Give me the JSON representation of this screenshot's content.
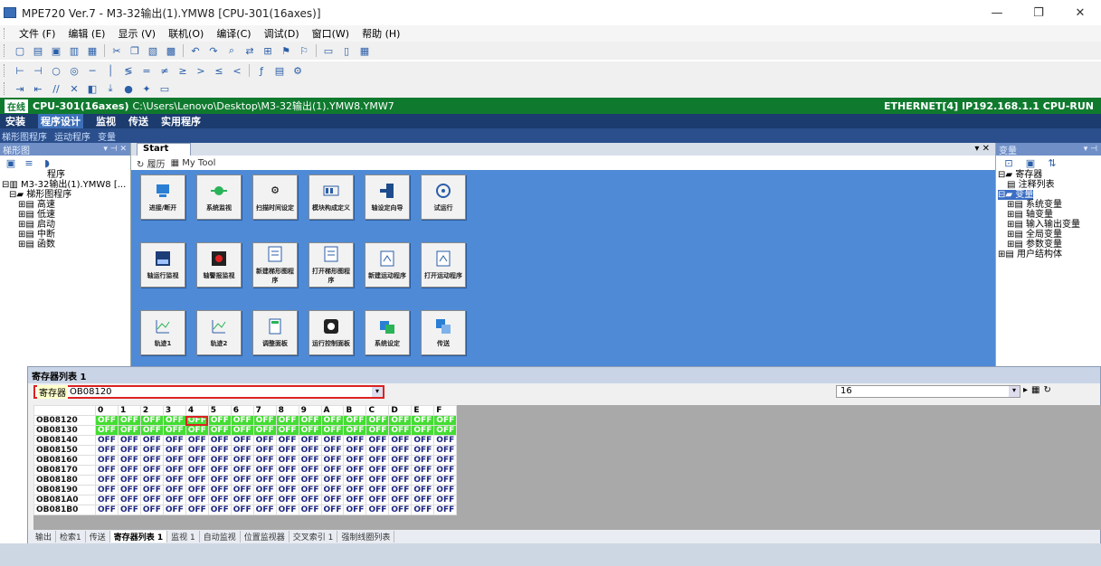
{
  "window": {
    "title": "MPE720 Ver.7 - M3-32输出(1).YMW8 [CPU-301(16axes)]",
    "controls": [
      "—",
      "❐",
      "✕"
    ]
  },
  "menu": [
    "文件 (F)",
    "编辑 (E)",
    "显示 (V)",
    "联机(O)",
    "编译(C)",
    "调试(D)",
    "窗口(W)",
    "帮助 (H)"
  ],
  "online": {
    "badge": "在线",
    "cpu": "CPU-301(16axes)",
    "path": "C:\\Users\\Lenovo\\Desktop\\M3-32输出(1).YMW8.YMW7",
    "connection": "ETHERNET[4] IP192.168.1.1 CPU-RUN",
    "color": "#0f7a2e"
  },
  "mainmenu": {
    "row1": [
      "安装",
      "程序设计",
      "监视",
      "传送",
      "实用程序"
    ],
    "active": "程序设计",
    "row2": [
      "梯形图程序",
      "运动程序",
      "变量"
    ]
  },
  "left": {
    "header": "梯形图",
    "tree": {
      "root_label": "程序",
      "project": "M3-32输出(1).YMW8 [...",
      "ladder": "梯形图程序",
      "children": [
        "高速",
        "低速",
        "启动",
        "中断",
        "函数"
      ]
    }
  },
  "center": {
    "tab": "Start",
    "subtoolbar": [
      "履历",
      "My Tool"
    ],
    "tiles": [
      [
        "进接/断开",
        "系统监视",
        "扫描时间设定",
        "模块构成定义",
        "轴设定向导",
        "试运行"
      ],
      [
        "轴运行监视",
        "轴警报监视",
        "新建梯形图程序",
        "打开梯形图程序",
        "新建运动程序",
        "打开运动程序"
      ],
      [
        "轨迹1",
        "轨迹2",
        "调整面板",
        "运行控制面板",
        "系统设定",
        "传送"
      ]
    ]
  },
  "right": {
    "header": "变量",
    "tree": [
      "寄存器",
      "注释列表",
      "变量",
      "系统变量",
      "轴变量",
      "输入输出变量",
      "全局变量",
      "参数变量",
      "用户结构体"
    ]
  },
  "registers": {
    "title": "寄存器列表 1",
    "combo_label": "寄存器",
    "combo_value": "OB08120",
    "size": "16",
    "columns": [
      "",
      "0",
      "1",
      "2",
      "3",
      "4",
      "5",
      "6",
      "7",
      "8",
      "9",
      "A",
      "B",
      "C",
      "D",
      "E",
      "F"
    ],
    "rows": [
      {
        "addr": "OB08120",
        "values": [
          "OFF",
          "OFF",
          "OFF",
          "OFF",
          "OFF",
          "OFF",
          "OFF",
          "OFF",
          "OFF",
          "OFF",
          "OFF",
          "OFF",
          "OFF",
          "OFF",
          "OFF",
          "OFF"
        ],
        "green": true
      },
      {
        "addr": "OB08130",
        "values": [
          "OFF",
          "OFF",
          "OFF",
          "OFF",
          "OFF",
          "OFF",
          "OFF",
          "OFF",
          "OFF",
          "OFF",
          "OFF",
          "OFF",
          "OFF",
          "OFF",
          "OFF",
          "OFF"
        ],
        "green": true
      },
      {
        "addr": "OB08140",
        "values": [
          "OFF",
          "OFF",
          "OFF",
          "OFF",
          "OFF",
          "OFF",
          "OFF",
          "OFF",
          "OFF",
          "OFF",
          "OFF",
          "OFF",
          "OFF",
          "OFF",
          "OFF",
          "OFF"
        ],
        "green": false
      },
      {
        "addr": "OB08150",
        "values": [
          "OFF",
          "OFF",
          "OFF",
          "OFF",
          "OFF",
          "OFF",
          "OFF",
          "OFF",
          "OFF",
          "OFF",
          "OFF",
          "OFF",
          "OFF",
          "OFF",
          "OFF",
          "OFF"
        ],
        "green": false
      },
      {
        "addr": "OB08160",
        "values": [
          "OFF",
          "OFF",
          "OFF",
          "OFF",
          "OFF",
          "OFF",
          "OFF",
          "OFF",
          "OFF",
          "OFF",
          "OFF",
          "OFF",
          "OFF",
          "OFF",
          "OFF",
          "OFF"
        ],
        "green": false
      },
      {
        "addr": "OB08170",
        "values": [
          "OFF",
          "OFF",
          "OFF",
          "OFF",
          "OFF",
          "OFF",
          "OFF",
          "OFF",
          "OFF",
          "OFF",
          "OFF",
          "OFF",
          "OFF",
          "OFF",
          "OFF",
          "OFF"
        ],
        "green": false
      },
      {
        "addr": "OB08180",
        "values": [
          "OFF",
          "OFF",
          "OFF",
          "OFF",
          "OFF",
          "OFF",
          "OFF",
          "OFF",
          "OFF",
          "OFF",
          "OFF",
          "OFF",
          "OFF",
          "OFF",
          "OFF",
          "OFF"
        ],
        "green": false
      },
      {
        "addr": "OB08190",
        "values": [
          "OFF",
          "OFF",
          "OFF",
          "OFF",
          "OFF",
          "OFF",
          "OFF",
          "OFF",
          "OFF",
          "OFF",
          "OFF",
          "OFF",
          "OFF",
          "OFF",
          "OFF",
          "OFF"
        ],
        "green": false
      },
      {
        "addr": "OB081A0",
        "values": [
          "OFF",
          "OFF",
          "OFF",
          "OFF",
          "OFF",
          "OFF",
          "OFF",
          "OFF",
          "OFF",
          "OFF",
          "OFF",
          "OFF",
          "OFF",
          "OFF",
          "OFF",
          "OFF"
        ],
        "green": false
      },
      {
        "addr": "OB081B0",
        "values": [
          "OFF",
          "OFF",
          "OFF",
          "OFF",
          "OFF",
          "OFF",
          "OFF",
          "OFF",
          "OFF",
          "OFF",
          "OFF",
          "OFF",
          "OFF",
          "OFF",
          "OFF",
          "OFF"
        ],
        "green": false
      }
    ],
    "highlight": {
      "row": 0,
      "col": 4
    },
    "green_color": "#44dd33"
  },
  "bottom_tabs": [
    "输出",
    "检索1",
    "传送",
    "寄存器列表 1",
    "监视 1",
    "自动监视",
    "位置监视器",
    "交叉索引 1",
    "强制线圈列表"
  ],
  "bottom_active": "寄存器列表 1"
}
